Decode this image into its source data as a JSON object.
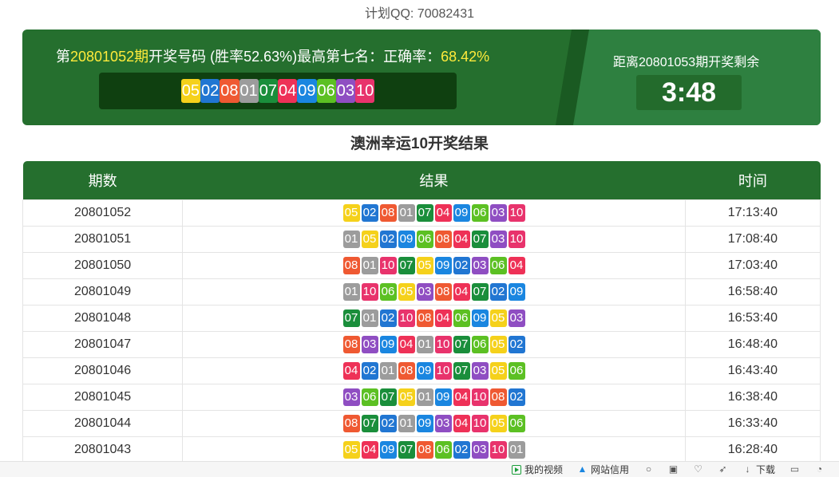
{
  "header": {
    "qq_label": "计划QQ:",
    "qq_number": "70082431"
  },
  "banner": {
    "prefix": "第",
    "issue": "20801052期",
    "mid": "开奖号码 (胜率52.63%)最高第七名：正确率：",
    "accuracy": "68.42%",
    "latest_numbers": [
      "05",
      "02",
      "08",
      "01",
      "07",
      "04",
      "09",
      "06",
      "03",
      "10"
    ],
    "countdown_label": "距离20801053期开奖剩余",
    "countdown": "3:48"
  },
  "section_title": "澳洲幸运10开奖结果",
  "table": {
    "headers": [
      "期数",
      "结果",
      "时间"
    ],
    "rows": [
      {
        "issue": "20801052",
        "numbers": [
          "05",
          "02",
          "08",
          "01",
          "07",
          "04",
          "09",
          "06",
          "03",
          "10"
        ],
        "time": "17:13:40"
      },
      {
        "issue": "20801051",
        "numbers": [
          "01",
          "05",
          "02",
          "09",
          "06",
          "08",
          "04",
          "07",
          "03",
          "10"
        ],
        "time": "17:08:40"
      },
      {
        "issue": "20801050",
        "numbers": [
          "08",
          "01",
          "10",
          "07",
          "05",
          "09",
          "02",
          "03",
          "06",
          "04"
        ],
        "time": "17:03:40"
      },
      {
        "issue": "20801049",
        "numbers": [
          "01",
          "10",
          "06",
          "05",
          "03",
          "08",
          "04",
          "07",
          "02",
          "09"
        ],
        "time": "16:58:40"
      },
      {
        "issue": "20801048",
        "numbers": [
          "07",
          "01",
          "02",
          "10",
          "08",
          "04",
          "06",
          "09",
          "05",
          "03"
        ],
        "time": "16:53:40"
      },
      {
        "issue": "20801047",
        "numbers": [
          "08",
          "03",
          "09",
          "04",
          "01",
          "10",
          "07",
          "06",
          "05",
          "02"
        ],
        "time": "16:48:40"
      },
      {
        "issue": "20801046",
        "numbers": [
          "04",
          "02",
          "01",
          "08",
          "09",
          "10",
          "07",
          "03",
          "05",
          "06"
        ],
        "time": "16:43:40"
      },
      {
        "issue": "20801045",
        "numbers": [
          "03",
          "06",
          "07",
          "05",
          "01",
          "09",
          "04",
          "10",
          "08",
          "02"
        ],
        "time": "16:38:40"
      },
      {
        "issue": "20801044",
        "numbers": [
          "08",
          "07",
          "02",
          "01",
          "09",
          "03",
          "04",
          "10",
          "05",
          "06"
        ],
        "time": "16:33:40"
      },
      {
        "issue": "20801043",
        "numbers": [
          "05",
          "04",
          "09",
          "07",
          "08",
          "06",
          "02",
          "03",
          "10",
          "01"
        ],
        "time": "16:28:40"
      }
    ]
  },
  "number_colors": {
    "01": "#9c9c9c",
    "02": "#2176d2",
    "03": "#8f4ec2",
    "04": "#ee3157",
    "05": "#f5d11b",
    "06": "#5cc023",
    "07": "#1a8e3b",
    "08": "#ef5932",
    "09": "#1a86e0",
    "10": "#e8336c"
  },
  "statusbar": {
    "items": [
      {
        "icon": "video-icon",
        "label": "我的视频"
      },
      {
        "icon": "drop-icon",
        "label": "网站信用"
      },
      {
        "icon": "shield-icon",
        "label": ""
      },
      {
        "icon": "image-icon",
        "label": ""
      },
      {
        "icon": "heartbeat-icon",
        "label": ""
      },
      {
        "icon": "rocket-icon",
        "label": ""
      },
      {
        "icon": "download-icon",
        "label": "下载"
      },
      {
        "icon": "car-icon",
        "label": ""
      },
      {
        "icon": "speed-icon",
        "label": ""
      }
    ]
  }
}
